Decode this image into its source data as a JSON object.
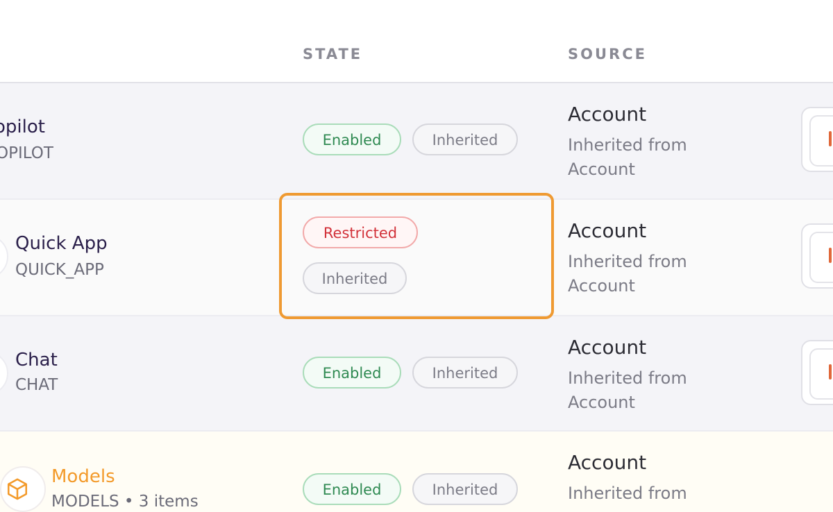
{
  "columns": {
    "state": "STATE",
    "source": "SOURCE"
  },
  "rows": [
    {
      "name": "opilot",
      "code": "OPILOT",
      "state": "Enabled",
      "inherit": "Inherited",
      "source_title": "Account",
      "source_desc": "Inherited from Account"
    },
    {
      "name": "Quick App",
      "code": "QUICK_APP",
      "state": "Restricted",
      "inherit": "Inherited",
      "source_title": "Account",
      "source_desc": "Inherited from Account"
    },
    {
      "name": "Chat",
      "code": "CHAT",
      "state": "Enabled",
      "inherit": "Inherited",
      "source_title": "Account",
      "source_desc": "Inherited from Account"
    },
    {
      "name": "Models",
      "code": "MODELS • 3 items",
      "state": "Enabled",
      "inherit": "Inherited",
      "source_title": "Account",
      "source_desc": "Inherited from"
    }
  ],
  "colors": {
    "enabled": "#2f8a52",
    "restricted": "#d2323a",
    "highlight": "#ef9a32",
    "models_accent": "#f39a2a"
  },
  "icons": {
    "models": "cube-icon"
  }
}
